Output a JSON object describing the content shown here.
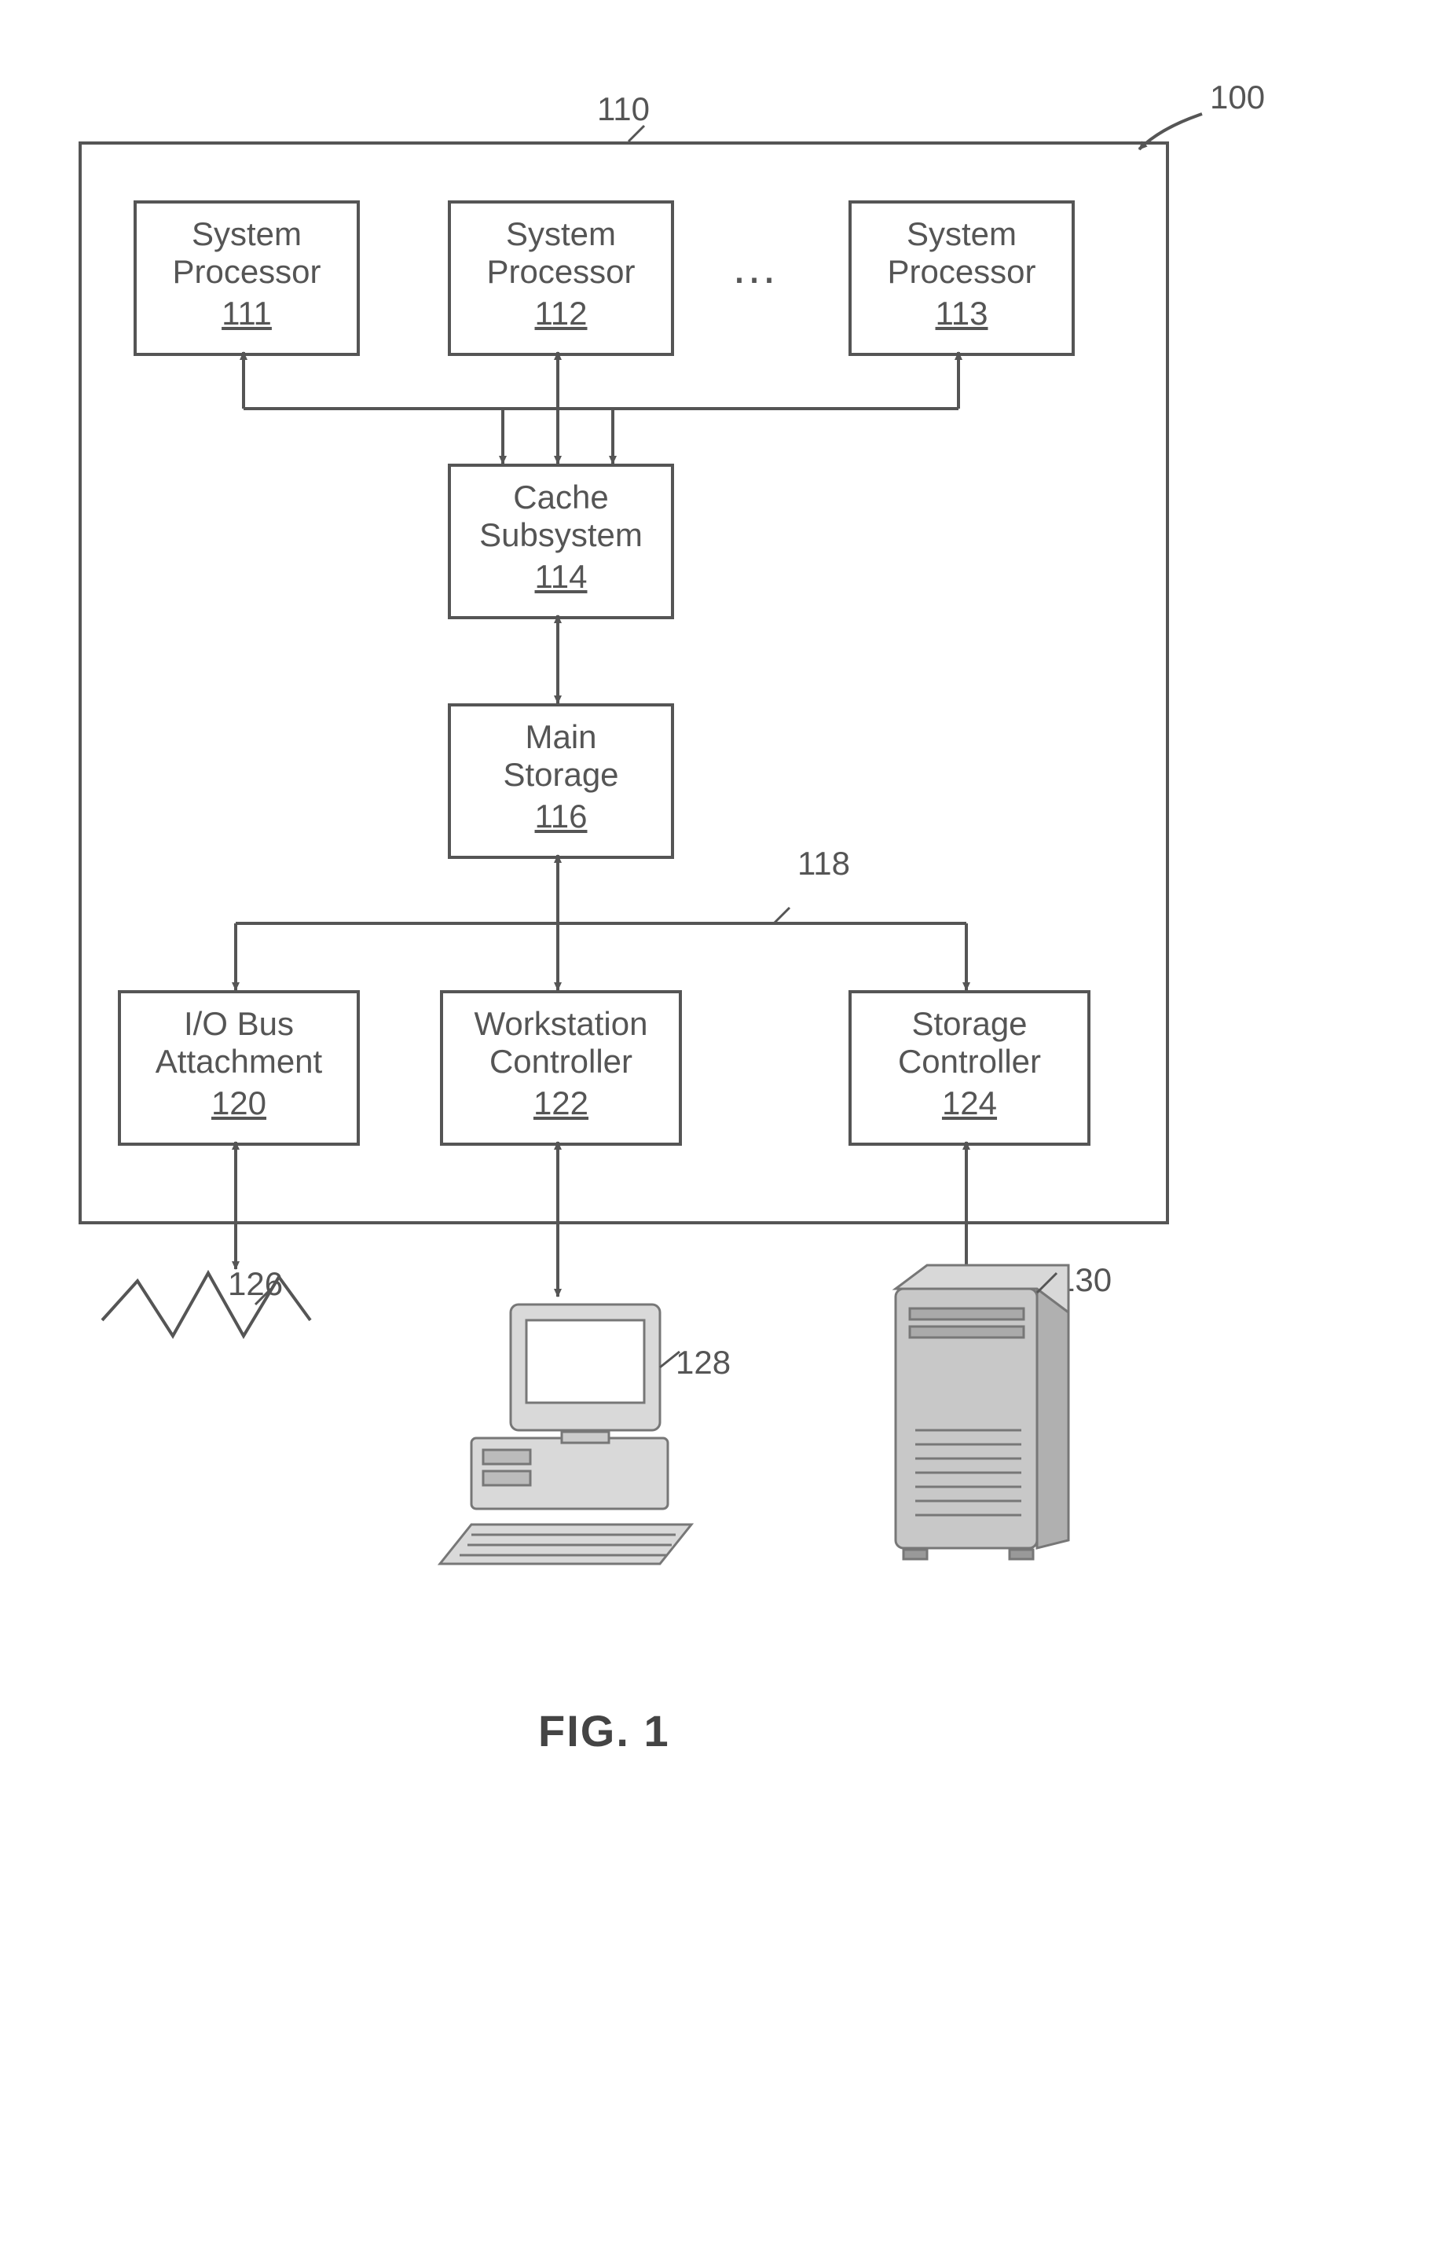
{
  "figure": {
    "caption": "FIG. 1",
    "ref_100": "100",
    "ref_110": "110",
    "ref_118": "118",
    "ref_126": "126",
    "ref_128": "128",
    "ref_130": "130",
    "ellipsis": "…"
  },
  "blocks": {
    "sp1": {
      "title": "System\nProcessor",
      "num": "111"
    },
    "sp2": {
      "title": "System\nProcessor",
      "num": "112"
    },
    "sp3": {
      "title": "System\nProcessor",
      "num": "113"
    },
    "cache": {
      "title": "Cache\nSubsystem",
      "num": "114"
    },
    "main_storage": {
      "title": "Main\nStorage",
      "num": "116"
    },
    "io_bus": {
      "title": "I/O Bus\nAttachment",
      "num": "120"
    },
    "ws_ctrl": {
      "title": "Workstation\nController",
      "num": "122"
    },
    "stor_ctrl": {
      "title": "Storage\nController",
      "num": "124"
    }
  }
}
